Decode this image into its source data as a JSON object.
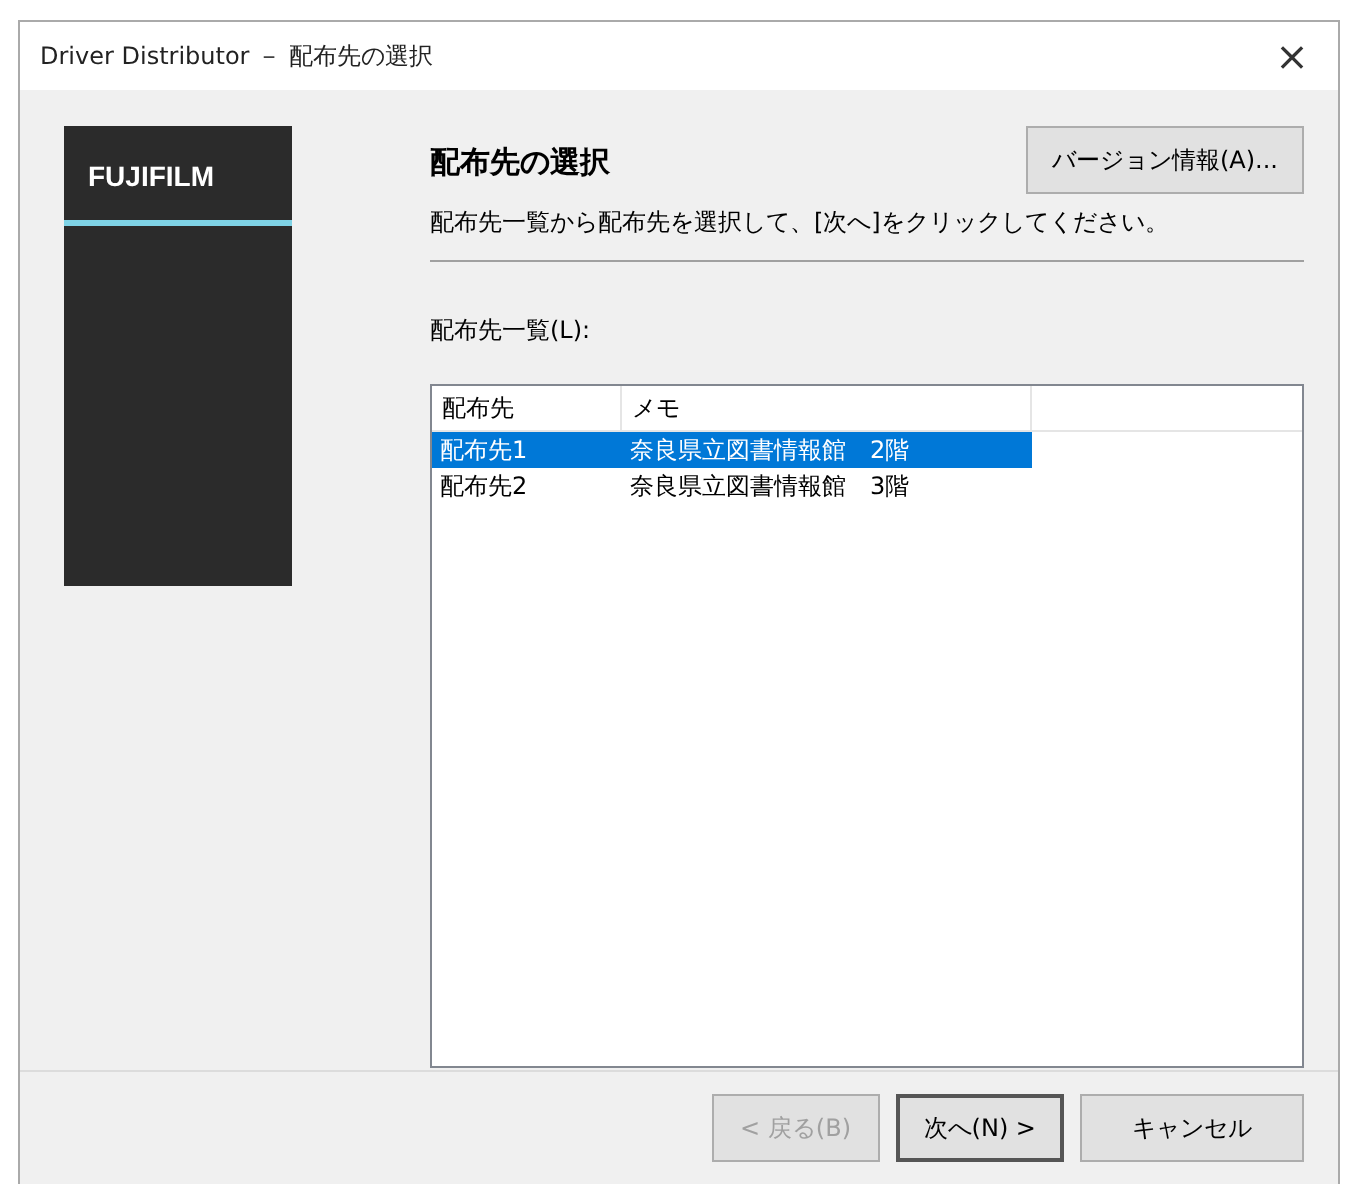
{
  "window": {
    "title": "Driver Distributor － 配布先の選択",
    "close": "×"
  },
  "logo": {
    "text": "FUJIFILM"
  },
  "header": {
    "title": "配布先の選択",
    "description": "配布先一覧から配布先を選択して、[次へ]をクリックしてください。",
    "version_button": "バージョン情報(A)..."
  },
  "list": {
    "label": "配布先一覧(L):",
    "columns": [
      "配布先",
      "メモ"
    ],
    "rows": [
      {
        "cells": [
          "配布先1",
          "奈良県立図書情報館　2階"
        ],
        "selected": true
      },
      {
        "cells": [
          "配布先2",
          "奈良県立図書情報館　3階"
        ],
        "selected": false
      }
    ]
  },
  "buttons": [
    {
      "label": "< 戻る(B)",
      "disabled": true,
      "default": false
    },
    {
      "label": "次へ(N) >",
      "disabled": false,
      "default": true
    },
    {
      "label": "キャンセル",
      "disabled": false,
      "default": false
    }
  ]
}
